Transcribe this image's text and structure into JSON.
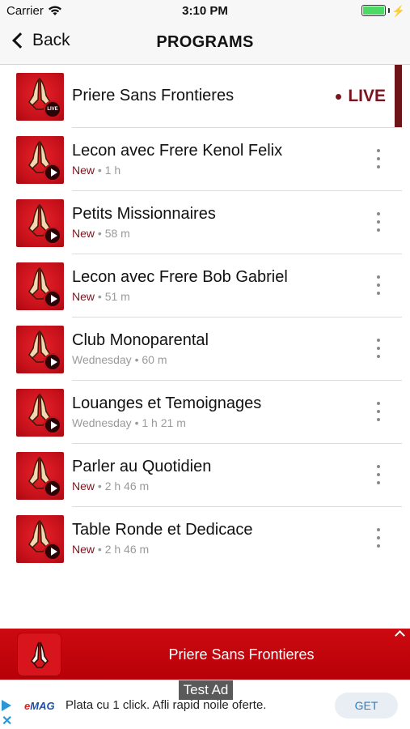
{
  "status_bar": {
    "carrier": "Carrier",
    "time": "3:10 PM"
  },
  "nav": {
    "back_label": "Back",
    "title": "PROGRAMS"
  },
  "programs": [
    {
      "title": "Priere Sans Frontieres",
      "live_label": "LIVE",
      "badge": "LIVE",
      "is_live": true
    },
    {
      "title": " Lecon avec Frere Kenol Felix",
      "status": "New",
      "duration": "1 h"
    },
    {
      "title": "Petits Missionnaires",
      "status": "New",
      "duration": "58 m"
    },
    {
      "title": "Lecon avec Frere Bob Gabriel",
      "status": "New",
      "duration": "51 m"
    },
    {
      "title": "Club Monoparental",
      "status": "Wednesday",
      "duration": "60 m"
    },
    {
      "title": "Louanges et Temoignages",
      "status": "Wednesday",
      "duration": "1 h 21 m"
    },
    {
      "title": "Parler au Quotidien",
      "status": "New",
      "duration": "2 h 46 m"
    },
    {
      "title": "Table Ronde et Dedicace",
      "status": "New",
      "duration": "2 h 46 m"
    }
  ],
  "separator": "•",
  "player": {
    "title": "Priere Sans Frontieres"
  },
  "ad": {
    "label": "Test Ad",
    "brand_prefix": "e",
    "brand_suffix": "MAG",
    "text": "Plata cu 1 click. Afli rapid noile oferte.",
    "cta": "GET"
  },
  "colors": {
    "brand_red": "#c4101a",
    "live_maroon": "#7a1520",
    "accent_blue": "#2a7fc8"
  }
}
